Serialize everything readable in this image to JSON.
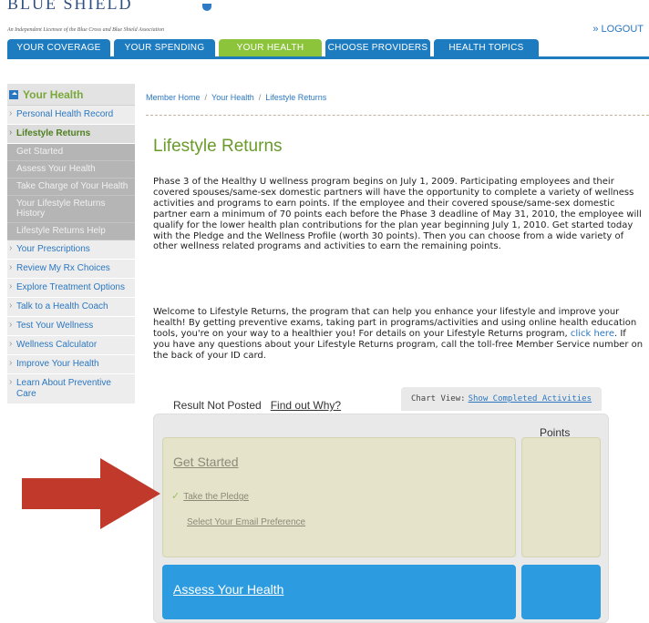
{
  "header": {
    "brand": "BLUE SHIELD",
    "licensee": "An Independent Licensee of the Blue Cross and Blue Shield Association",
    "logout": "» LOGOUT",
    "tabs": [
      "YOUR COVERAGE",
      "YOUR SPENDING",
      "YOUR HEALTH",
      "CHOOSE PROVIDERS",
      "HEALTH TOPICS"
    ],
    "active_tab": "YOUR HEALTH"
  },
  "sidebar": {
    "title": "Your Health",
    "items": [
      "Personal Health Record",
      "Lifestyle Returns",
      "Your Prescriptions",
      "Review My Rx Choices",
      "Explore Treatment Options",
      "Talk to a Health Coach",
      "Test Your Wellness",
      "Wellness Calculator",
      "Improve Your Health",
      "Learn About Preventive Care"
    ],
    "subitems": [
      "Get Started",
      "Assess Your Health",
      "Take Charge of Your Health",
      "Your Lifestyle Returns History",
      "Lifestyle Returns Help"
    ]
  },
  "breadcrumb": [
    "Member Home",
    "Your Health",
    "Lifestyle Returns"
  ],
  "main": {
    "title": "Lifestyle Returns",
    "para1": "Phase 3 of the Healthy U wellness program begins on July 1, 2009. Participating employees and their covered spouses/same-sex domestic partners will have the opportunity to complete a variety of wellness activities and programs to earn points. If the employee and their covered spouse/same-sex domestic partner earn a minimum of 70 points each before the Phase 3 deadline of May 31, 2010, the employee will qualify for the lower health plan contributions for the plan year beginning July 1, 2010. Get started today with the Pledge and the Wellness Profile (worth 30 points). Then you can choose from a wide variety of other wellness related programs and activities to earn the remaining points.",
    "para2_before": "Welcome to Lifestyle Returns, the program that can help you enhance your lifestyle and improve your health! By getting preventive exams, taking part in programs/activities and using online health education tools, you're on your way to a healthier you! For details on your Lifestyle Returns program,",
    "para2_link": "click here",
    "para2_after": ". If you have any questions about your Lifestyle Returns program, call the toll-free Member Service number on the back of your ID card."
  },
  "activities": {
    "result_status": "Result Not Posted",
    "find_out_why": "Find out Why?",
    "chart_view_label": "Chart View:",
    "chart_view_link": "Show Completed Activities",
    "points_header": "Points",
    "get_started_title": "Get Started",
    "get_started_items": [
      "Take the Pledge",
      "Select Your Email Preference"
    ],
    "check_glyph": "✓",
    "assess_title": "Assess Your Health"
  },
  "colors": {
    "tab_blue": "#1d7bbf",
    "tab_active_green": "#8cc43c",
    "title_green": "#6a9a2a",
    "link_blue": "#2b77c0",
    "arrow_red": "#c0392b",
    "assess_blue": "#2d9be0",
    "get_started_beige": "#e5e3c9"
  }
}
